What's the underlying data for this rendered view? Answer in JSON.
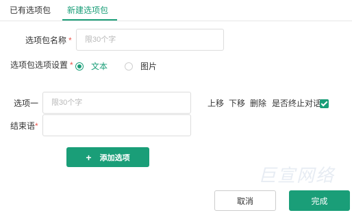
{
  "tabs": [
    {
      "label": "已有选项包"
    },
    {
      "label": "新建选项包",
      "active": true
    }
  ],
  "form": {
    "name_label": "选项包名称",
    "required_mark": "*",
    "name_placeholder": "限30个字",
    "settings_label": "选项包选项设置",
    "radio_options": [
      {
        "label": "文本",
        "checked": true
      },
      {
        "label": "图片",
        "checked": false
      }
    ],
    "option_label": "选项一",
    "option_placeholder": "限30个字",
    "actions": {
      "move_up": "上移",
      "move_down": "下移",
      "delete": "删除",
      "end_dialog": "是否终止对话",
      "end_dialog_checked": true
    },
    "end_label": "结束语",
    "end_value": "",
    "add_button": "添加选项"
  },
  "footer": {
    "cancel": "取消",
    "done": "完成"
  },
  "watermark": "巨宣网络",
  "colors": {
    "accent": "#1a9e78",
    "required": "#e8534b"
  }
}
